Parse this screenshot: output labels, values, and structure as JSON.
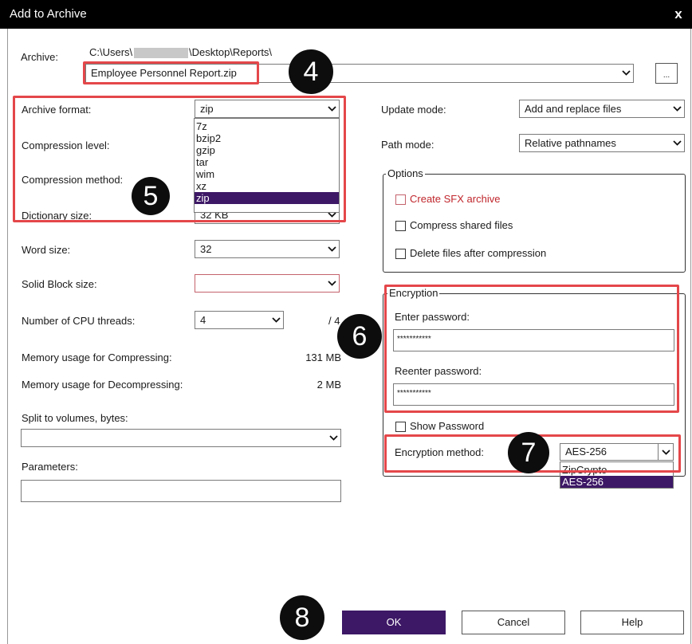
{
  "window": {
    "title": "Add to Archive",
    "close_label": "x"
  },
  "archive": {
    "label": "Archive:",
    "path_prefix": "C:\\Users\\",
    "path_suffix": "\\Desktop\\Reports\\",
    "filename": "Employee Personnel Report.zip",
    "browse_label": "..."
  },
  "left": {
    "archive_format": {
      "label": "Archive format:",
      "value": "zip",
      "options": [
        "7z",
        "bzip2",
        "gzip",
        "tar",
        "wim",
        "xz",
        "zip"
      ],
      "selected": "zip"
    },
    "compression_level": {
      "label": "Compression level:"
    },
    "compression_method": {
      "label": "Compression method:"
    },
    "dictionary_size": {
      "label": "Dictionary size:",
      "value": "32 KB"
    },
    "word_size": {
      "label": "Word size:",
      "value": "32"
    },
    "solid_block": {
      "label": "Solid Block size:",
      "value": ""
    },
    "cpu_threads": {
      "label": "Number of CPU threads:",
      "value": "4",
      "max": "/ 4"
    },
    "mem_compress": {
      "label": "Memory usage for Compressing:",
      "value": "131 MB"
    },
    "mem_decompress": {
      "label": "Memory usage for Decompressing:",
      "value": "2 MB"
    },
    "split": {
      "label": "Split to volumes, bytes:",
      "value": ""
    },
    "parameters": {
      "label": "Parameters:",
      "value": ""
    }
  },
  "right": {
    "update_mode": {
      "label": "Update mode:",
      "value": "Add and replace files"
    },
    "path_mode": {
      "label": "Path mode:",
      "value": "Relative pathnames"
    },
    "options": {
      "legend": "Options",
      "create_sfx": "Create SFX archive",
      "compress_shared": "Compress shared files",
      "delete_after": "Delete files after compression"
    },
    "encryption": {
      "legend": "Encryption",
      "enter_label": "Enter password:",
      "enter_value": "***********",
      "reenter_label": "Reenter password:",
      "reenter_value": "***********",
      "show_password": "Show Password",
      "method_label": "Encryption method:",
      "method_value": "AES-256",
      "method_options": [
        "ZipCrypto",
        "AES-256"
      ],
      "method_selected": "AES-256"
    }
  },
  "buttons": {
    "ok": "OK",
    "cancel": "Cancel",
    "help": "Help"
  },
  "callouts": {
    "c4": "4",
    "c5": "5",
    "c6": "6",
    "c7": "7",
    "c8": "8"
  },
  "colors": {
    "highlight_red": "#e4474a",
    "selection_purple": "#3d1866",
    "ok_button": "#3d1866",
    "callout_black": "#0d0d0d"
  }
}
